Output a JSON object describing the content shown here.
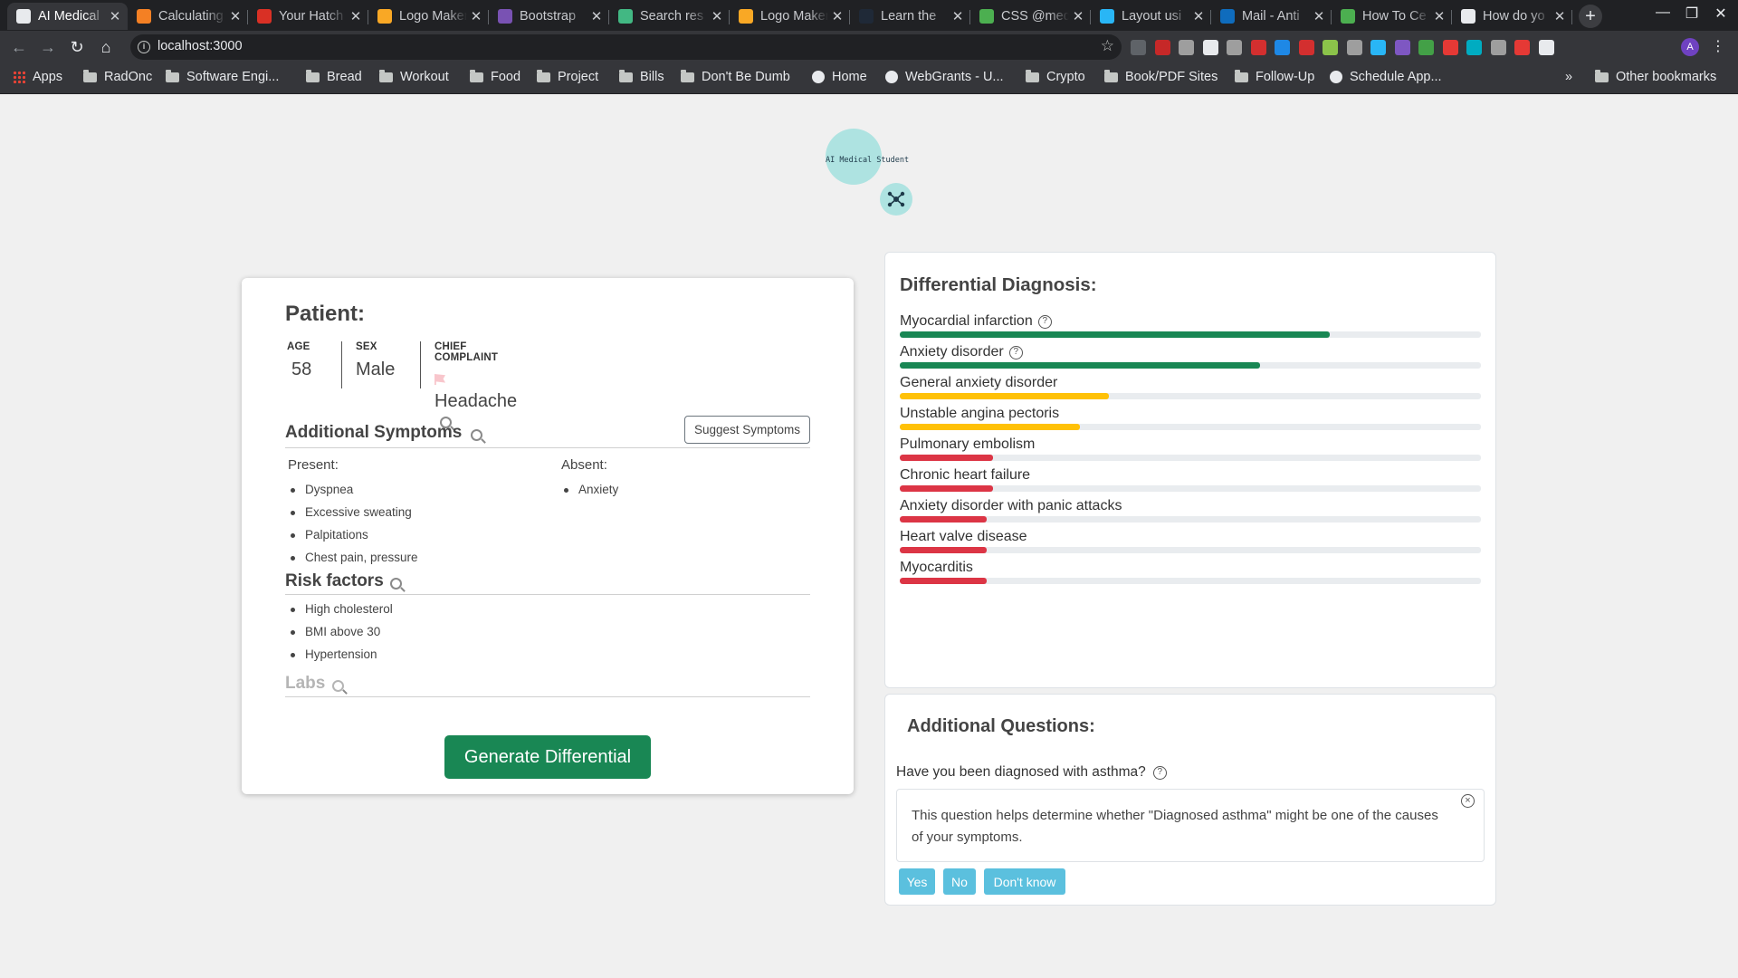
{
  "browser": {
    "tabs": [
      {
        "title": "AI Medical",
        "active": true,
        "icon": "doc-icon",
        "color": "#e8eaed"
      },
      {
        "title": "Calculating",
        "icon": "stackoverflow-icon",
        "color": "#f48024"
      },
      {
        "title": "Your Hatch",
        "icon": "gmail-icon",
        "color": "#d93025"
      },
      {
        "title": "Logo Maker",
        "icon": "logo-maker-icon",
        "color": "#f9a825"
      },
      {
        "title": "Bootstrap",
        "icon": "bootstrap-icon",
        "color": "#7952b3"
      },
      {
        "title": "Search res",
        "icon": "vue-icon",
        "color": "#42b883"
      },
      {
        "title": "Logo Maker",
        "icon": "logo-maker-icon",
        "color": "#f9a825"
      },
      {
        "title": "Learn the",
        "icon": "a-icon",
        "color": "#1f2937"
      },
      {
        "title": "CSS @med",
        "icon": "caniuse-icon",
        "color": "#4caf50"
      },
      {
        "title": "Layout usi",
        "icon": "layout-icon",
        "color": "#29b6f6"
      },
      {
        "title": "Mail - Anti",
        "icon": "outlook-icon",
        "color": "#0f6cbd"
      },
      {
        "title": "How To Ce",
        "icon": "caniuse-icon",
        "color": "#4caf50"
      },
      {
        "title": "How do yo",
        "icon": "github-icon",
        "color": "#e8eaed"
      }
    ],
    "new_tab_label": "+",
    "url": "localhost:3000",
    "profile_initial": "A",
    "bookmarks": [
      {
        "label": "Apps",
        "icon": "apps-icon"
      },
      {
        "label": "RadOnc",
        "icon": "folder-icon"
      },
      {
        "label": "Software Engi...",
        "icon": "folder-icon"
      },
      {
        "label": "Bread",
        "icon": "folder-icon"
      },
      {
        "label": "Workout",
        "icon": "folder-icon"
      },
      {
        "label": "Food",
        "icon": "folder-icon"
      },
      {
        "label": "Project",
        "icon": "folder-icon"
      },
      {
        "label": "Bills",
        "icon": "folder-icon"
      },
      {
        "label": "Don't Be Dumb",
        "icon": "folder-icon"
      },
      {
        "label": "Home",
        "icon": "globe-icon"
      },
      {
        "label": "WebGrants - U...",
        "icon": "globe-icon"
      },
      {
        "label": "Crypto",
        "icon": "folder-icon"
      },
      {
        "label": "Book/PDF Sites",
        "icon": "folder-icon"
      },
      {
        "label": "Follow-Up",
        "icon": "folder-icon"
      },
      {
        "label": "Schedule App...",
        "icon": "globe-icon"
      }
    ],
    "overflow_label": "»",
    "other_bookmarks": "Other bookmarks"
  },
  "app": {
    "logo_text": "AI Medical Student",
    "patient": {
      "title": "Patient:",
      "age_label": "AGE",
      "age": "58",
      "sex_label": "SEX",
      "sex": "Male",
      "complaint_label": "CHIEF COMPLAINT",
      "complaint": "Headache"
    },
    "additional_symptoms": {
      "title": "Additional Symptoms",
      "suggest_label": "Suggest Symptoms",
      "present_label": "Present:",
      "present": [
        "Dyspnea",
        "Excessive sweating",
        "Palpitations",
        "Chest pain, pressure"
      ],
      "absent_label": "Absent:",
      "absent": [
        "Anxiety"
      ]
    },
    "risk_factors": {
      "title": "Risk factors",
      "items": [
        "High cholesterol",
        "BMI above 30",
        "Hypertension"
      ]
    },
    "labs": {
      "title": "Labs"
    },
    "generate_label": "Generate Differential",
    "differential": {
      "title": "Differential Diagnosis:",
      "items": [
        {
          "name": "Myocardial infarction",
          "info": true,
          "level": 0.74,
          "color": "#198754"
        },
        {
          "name": "Anxiety disorder",
          "info": true,
          "level": 0.62,
          "color": "#198754"
        },
        {
          "name": "General anxiety disorder",
          "info": false,
          "level": 0.36,
          "color": "#ffc107"
        },
        {
          "name": "Unstable angina pectoris",
          "info": false,
          "level": 0.31,
          "color": "#ffc107"
        },
        {
          "name": "Pulmonary embolism",
          "info": false,
          "level": 0.16,
          "color": "#dc3545"
        },
        {
          "name": "Chronic heart failure",
          "info": false,
          "level": 0.16,
          "color": "#dc3545"
        },
        {
          "name": "Anxiety disorder with panic attacks",
          "info": false,
          "level": 0.15,
          "color": "#dc3545"
        },
        {
          "name": "Heart valve disease",
          "info": false,
          "level": 0.15,
          "color": "#dc3545"
        },
        {
          "name": "Myocarditis",
          "info": false,
          "level": 0.15,
          "color": "#dc3545"
        }
      ]
    },
    "additional_questions": {
      "title": "Additional Questions:",
      "question": "Have you been diagnosed with asthma?",
      "explanation": "This question helps determine whether \"Diagnosed asthma\" might be one of the causes of your symptoms.",
      "answers": [
        "Yes",
        "No",
        "Don't know"
      ]
    }
  }
}
